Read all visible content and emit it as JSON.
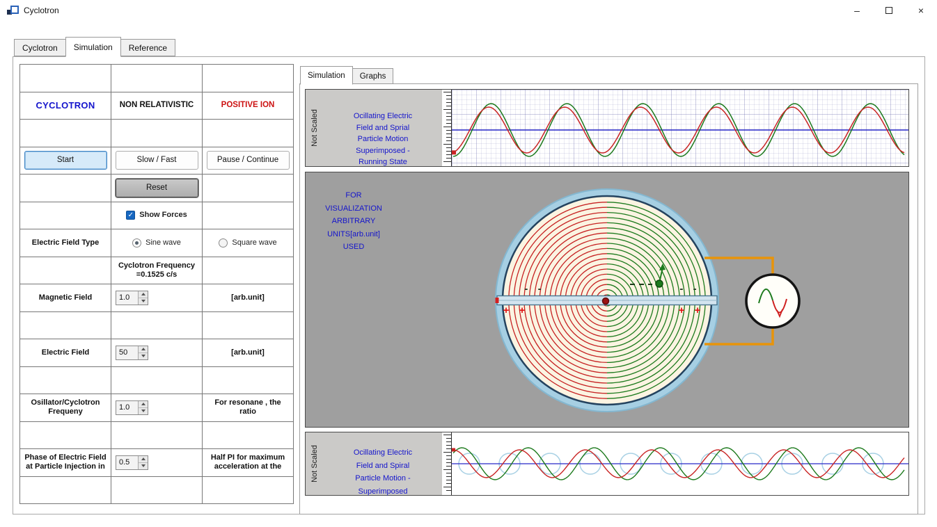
{
  "window": {
    "title": "Cyclotron"
  },
  "main_tabs": {
    "cyclotron": "Cyclotron",
    "simulation": "Simulation",
    "reference": "Reference"
  },
  "control_panel": {
    "title_row": {
      "name": "CYCLOTRON",
      "mode": "NON RELATIVISTIC",
      "ion": "POSITIVE ION"
    },
    "buttons": {
      "start": "Start",
      "slow_fast": "Slow / Fast",
      "pause_continue": "Pause / Continue",
      "reset": "Reset"
    },
    "show_forces": {
      "label": "Show Forces",
      "checked": true
    },
    "field_type": {
      "label": "Electric Field Type",
      "sine": "Sine wave",
      "square": "Square wave",
      "selected": "Sine wave"
    },
    "frequency_note": {
      "line1": "Cyclotron Frequency",
      "line2": "=0.1525 c/s"
    },
    "magnetic_field": {
      "label": "Magnetic Field",
      "value": "1.0",
      "unit": "[arb.unit]"
    },
    "electric_field": {
      "label": "Electric Field",
      "value": "50",
      "unit": "[arb.unit]"
    },
    "osc_ratio": {
      "label1": "Osillator/Cyclotron",
      "label2": "Frequeny",
      "value": "1.0",
      "note1": "For resonane , the",
      "note2": "ratio"
    },
    "phase": {
      "label1": "Phase of Electric Field",
      "label2": "at Particle Injection in",
      "value": "0.5",
      "note1": "Half PI for maximum",
      "note2": "acceleration at the"
    }
  },
  "sim_panel": {
    "tabs": {
      "simulation": "Simulation",
      "graphs": "Graphs"
    },
    "top_strip": {
      "side_label": "Not Scaled",
      "line1": "Ocillating Electric",
      "line2": "Field and Sprial",
      "line3": "Particle Motion",
      "line4": "Superimposed -",
      "line5": "Running State"
    },
    "viz": {
      "line1": "FOR",
      "line2": "VISUALIZATION",
      "line3": "ARBITRARY",
      "line4": "UNITS[arb.unit]",
      "line5": "USED",
      "plus_signs": "+ +",
      "minus_signs": "- -"
    },
    "bottom_strip": {
      "side_label": "Not Scaled",
      "line1": "Ocillating Electric",
      "line2": "Field and Spiral",
      "line3": "Particle Motion -",
      "line4": "Superimposed"
    }
  },
  "colors": {
    "blue_text": "#1414cc",
    "red_text": "#cc1111",
    "wave_red": "#c92424",
    "wave_green": "#1d7a1d",
    "axis_blue": "#2828c8",
    "circle_blue": "#a7d0e4",
    "dee_fill": "#fbf4e2",
    "dee_ring": "#a6cfe3",
    "wire_orange": "#e8940a"
  }
}
